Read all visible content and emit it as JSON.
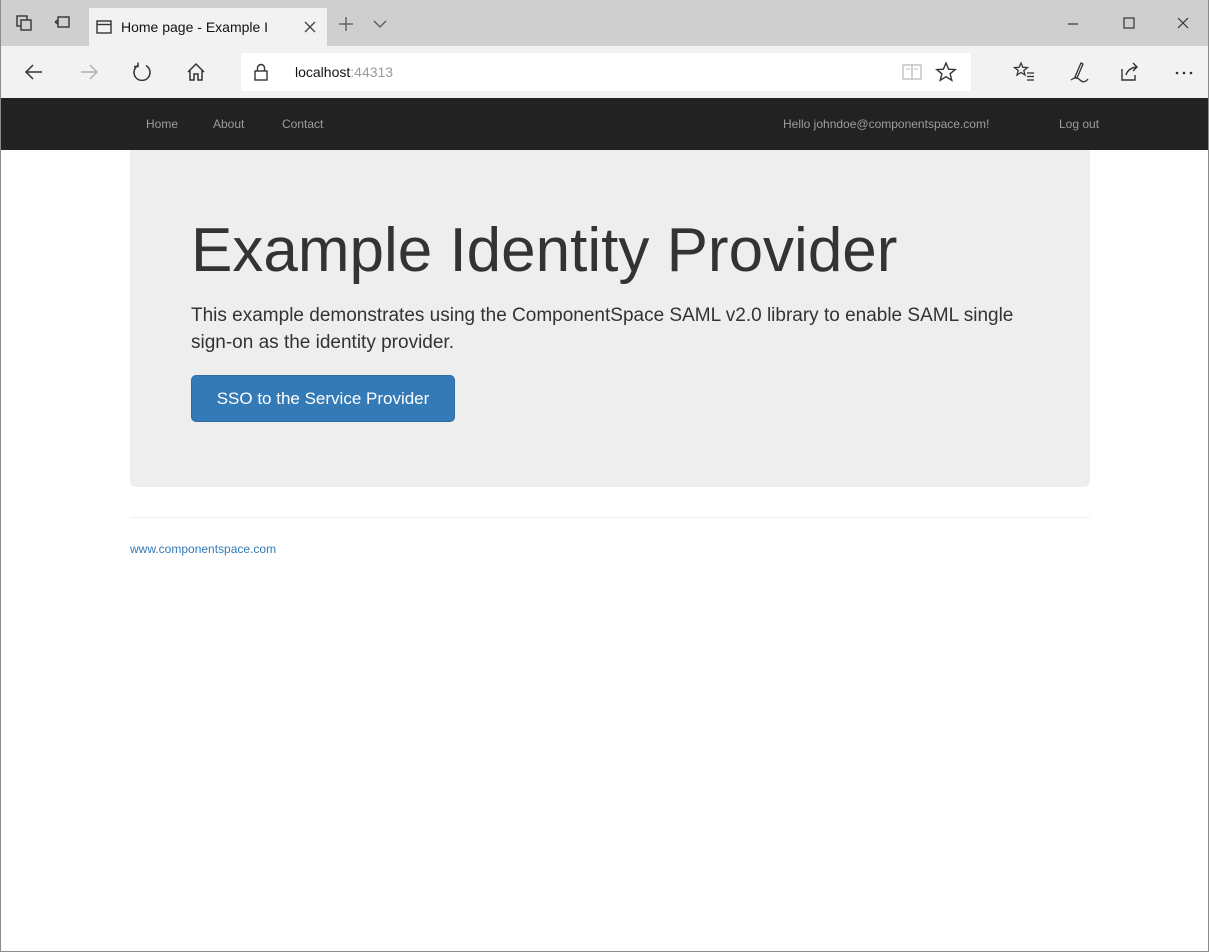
{
  "browser": {
    "tab": {
      "title": "Home page - Example I"
    },
    "address": {
      "host": "localhost",
      "port": ":44313"
    },
    "icons": {
      "tab_actions": "set-aside-tabs-icon",
      "tab_preview": "show-tab-previews-icon",
      "page": "page-icon",
      "close_tab": "close-icon",
      "new_tab": "plus-icon",
      "tab_list": "chevron-down-icon",
      "minimize": "minimize-icon",
      "maximize": "maximize-icon",
      "close_window": "close-icon",
      "back": "back-arrow-icon",
      "forward": "forward-arrow-icon",
      "refresh": "refresh-icon",
      "home": "home-icon",
      "lock": "lock-icon",
      "reading_view": "reading-view-icon",
      "favorite": "star-icon",
      "favorites_hub": "favorites-hub-icon",
      "web_note": "pen-icon",
      "share": "share-icon",
      "more": "more-icon"
    }
  },
  "site": {
    "nav": {
      "home": "Home",
      "about": "About",
      "contact": "Contact",
      "greeting": "Hello johndoe@componentspace.com!",
      "logout": "Log out"
    },
    "jumbotron": {
      "heading": "Example Identity Provider",
      "lead": "This example demonstrates using the ComponentSpace SAML v2.0 library to enable SAML single sign-on as the identity provider.",
      "button": "SSO to the Service Provider"
    },
    "footer": {
      "link": "www.componentspace.com"
    }
  },
  "colors": {
    "navbar_bg": "#222222",
    "navbar_text": "#9d9d9d",
    "jumbotron_bg": "#eeeeee",
    "primary": "#337ab7",
    "text": "#333333"
  }
}
